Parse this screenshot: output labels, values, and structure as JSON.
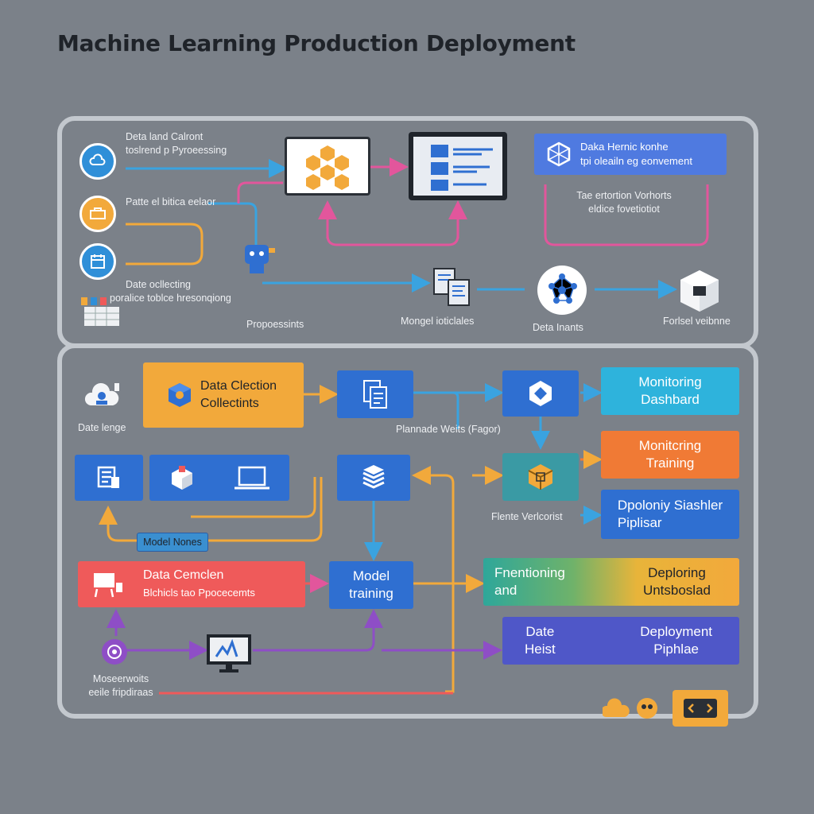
{
  "title": "Machine Learning Production Deployment",
  "top": {
    "label_data_and": [
      "Deta land Calront",
      "toslrend p Pyroeessing"
    ],
    "label_pattern": "Patte el bitica eelaor",
    "label_collecting": [
      "Date ocllecting",
      "poralice toblce hresonqiong"
    ],
    "label_processing": "Propoessints",
    "label_merge": "Mongel ioticlales",
    "label_data_inputs": "Deta Inants",
    "label_fostel": "Forlsel veibnne",
    "deploy_box_lines": [
      "Daka Hernic konhe",
      "tpi oleailn eg eonvement"
    ],
    "deploy_note": [
      "Tae ertortion Vorhorts",
      "eldice fovetiotiot"
    ]
  },
  "bottom": {
    "label_date_range": "Date lenge",
    "data_collection": [
      "Data Clection",
      "Collectints"
    ],
    "label_planned": "Plannade Weits (Fagor)",
    "monitoring_dashboard": [
      "Monitoring",
      "Dashbard"
    ],
    "monitoring_training": [
      "Monitcring",
      "Training"
    ],
    "deploying_stasher": [
      "Dpoloniy Siashler",
      "Piplisar"
    ],
    "label_flente": "Flente Verlcorist",
    "model_nodes": "Model Nones",
    "data_cemclen": [
      "Data Cemclen",
      "Blchicls tao Ppocecemts"
    ],
    "model_training": [
      "Model",
      "training"
    ],
    "fnentioning_and": [
      "Fnentioning",
      "and"
    ],
    "deploring_unts": [
      "Deploring",
      "Untsboslad"
    ],
    "date_heist": [
      "Date",
      "Heist"
    ],
    "deployment_pipeline": [
      "Deployment",
      "Piphlae"
    ],
    "label_meuserworks": [
      "Moseerwoits",
      "eeile fripdiraas"
    ]
  },
  "colors": {
    "background": "#7b8189",
    "panel_border": "#c3c8ce",
    "blue": "#2f6fd1",
    "orange": "#f2a93b",
    "cyan": "#2eb3dc",
    "orange_red": "#f07a35",
    "red": "#ef5a5a",
    "indigo": "#4f57c8",
    "pink": "#e2569c",
    "purple": "#8e4ec6"
  }
}
